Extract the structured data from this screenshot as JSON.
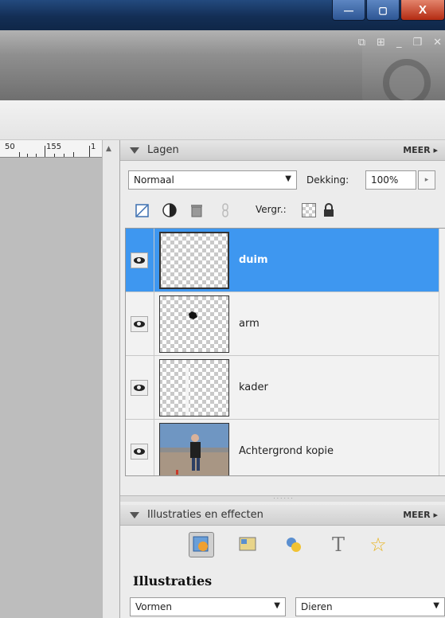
{
  "window": {
    "min_symbol": "—",
    "max_symbol": "▢",
    "close_symbol": "X"
  },
  "ruler": {
    "label_a": "50",
    "label_b": "155",
    "label_c": "1"
  },
  "layers_panel": {
    "title": "Lagen",
    "more_label": "MEER",
    "blend_mode": "Normaal",
    "opacity_label": "Dekking:",
    "opacity_value": "100%",
    "lock_label": "Vergr.:",
    "layers": [
      {
        "name": "duim",
        "visible": true,
        "selected": true
      },
      {
        "name": "arm",
        "visible": true,
        "selected": false
      },
      {
        "name": "kader",
        "visible": true,
        "selected": false
      },
      {
        "name": "Achtergrond kopie",
        "visible": true,
        "selected": false
      }
    ]
  },
  "effects_panel": {
    "title": "Illustraties en effecten",
    "more_label": "MEER",
    "section_title": "Illustraties",
    "icons": [
      "artwork-icon",
      "theme-icon",
      "filter-icon",
      "text-effects-icon",
      "favorites-star-icon"
    ],
    "category_select": "Vormen",
    "subcategory_select": "Dieren"
  },
  "colors": {
    "selection": "#3e97f0",
    "titlebar": "#1b3d6b",
    "close": "#c8452a"
  }
}
